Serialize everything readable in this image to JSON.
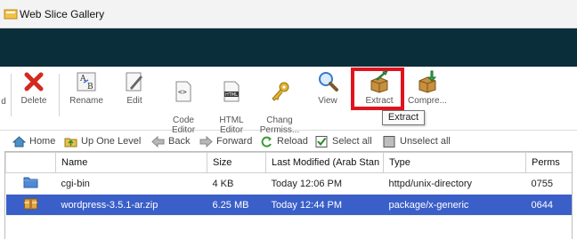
{
  "gallery": {
    "label": "Web Slice Gallery"
  },
  "toolbar": {
    "partial_left_label": "d",
    "buttons": [
      {
        "label": "Delete"
      },
      {
        "label": "Rename"
      },
      {
        "label": "Edit"
      },
      {
        "label": "Code\nEditor"
      },
      {
        "label": "HTML\nEditor"
      },
      {
        "label": "Chang\nPermiss..."
      },
      {
        "label": "View"
      },
      {
        "label": "Extract"
      },
      {
        "label": "Compre..."
      }
    ],
    "tooltip": "Extract"
  },
  "navbar": {
    "home": "Home",
    "up_one_level": "Up One Level",
    "back": "Back",
    "forward": "Forward",
    "reload": "Reload",
    "select_all": "Select all",
    "unselect_all": "Unselect all"
  },
  "table": {
    "columns": [
      "Name",
      "Size",
      "Last Modified (Arab Stan",
      "Type",
      "Perms"
    ],
    "rows": [
      {
        "icon": "folder-icon",
        "name": "cgi-bin",
        "size": "4 KB",
        "modified": "Today 12:06 PM",
        "type": "httpd/unix-directory",
        "perms": "0755",
        "selected": false
      },
      {
        "icon": "archive-icon",
        "name": "wordpress-3.5.1-ar.zip",
        "size": "6.25 MB",
        "modified": "Today 12:44 PM",
        "type": "package/x-generic",
        "perms": "0644",
        "selected": true
      }
    ]
  },
  "colors": {
    "banner": "#0a2e3a",
    "selected_row": "#3a5fc9",
    "highlight": "#e0141e"
  }
}
